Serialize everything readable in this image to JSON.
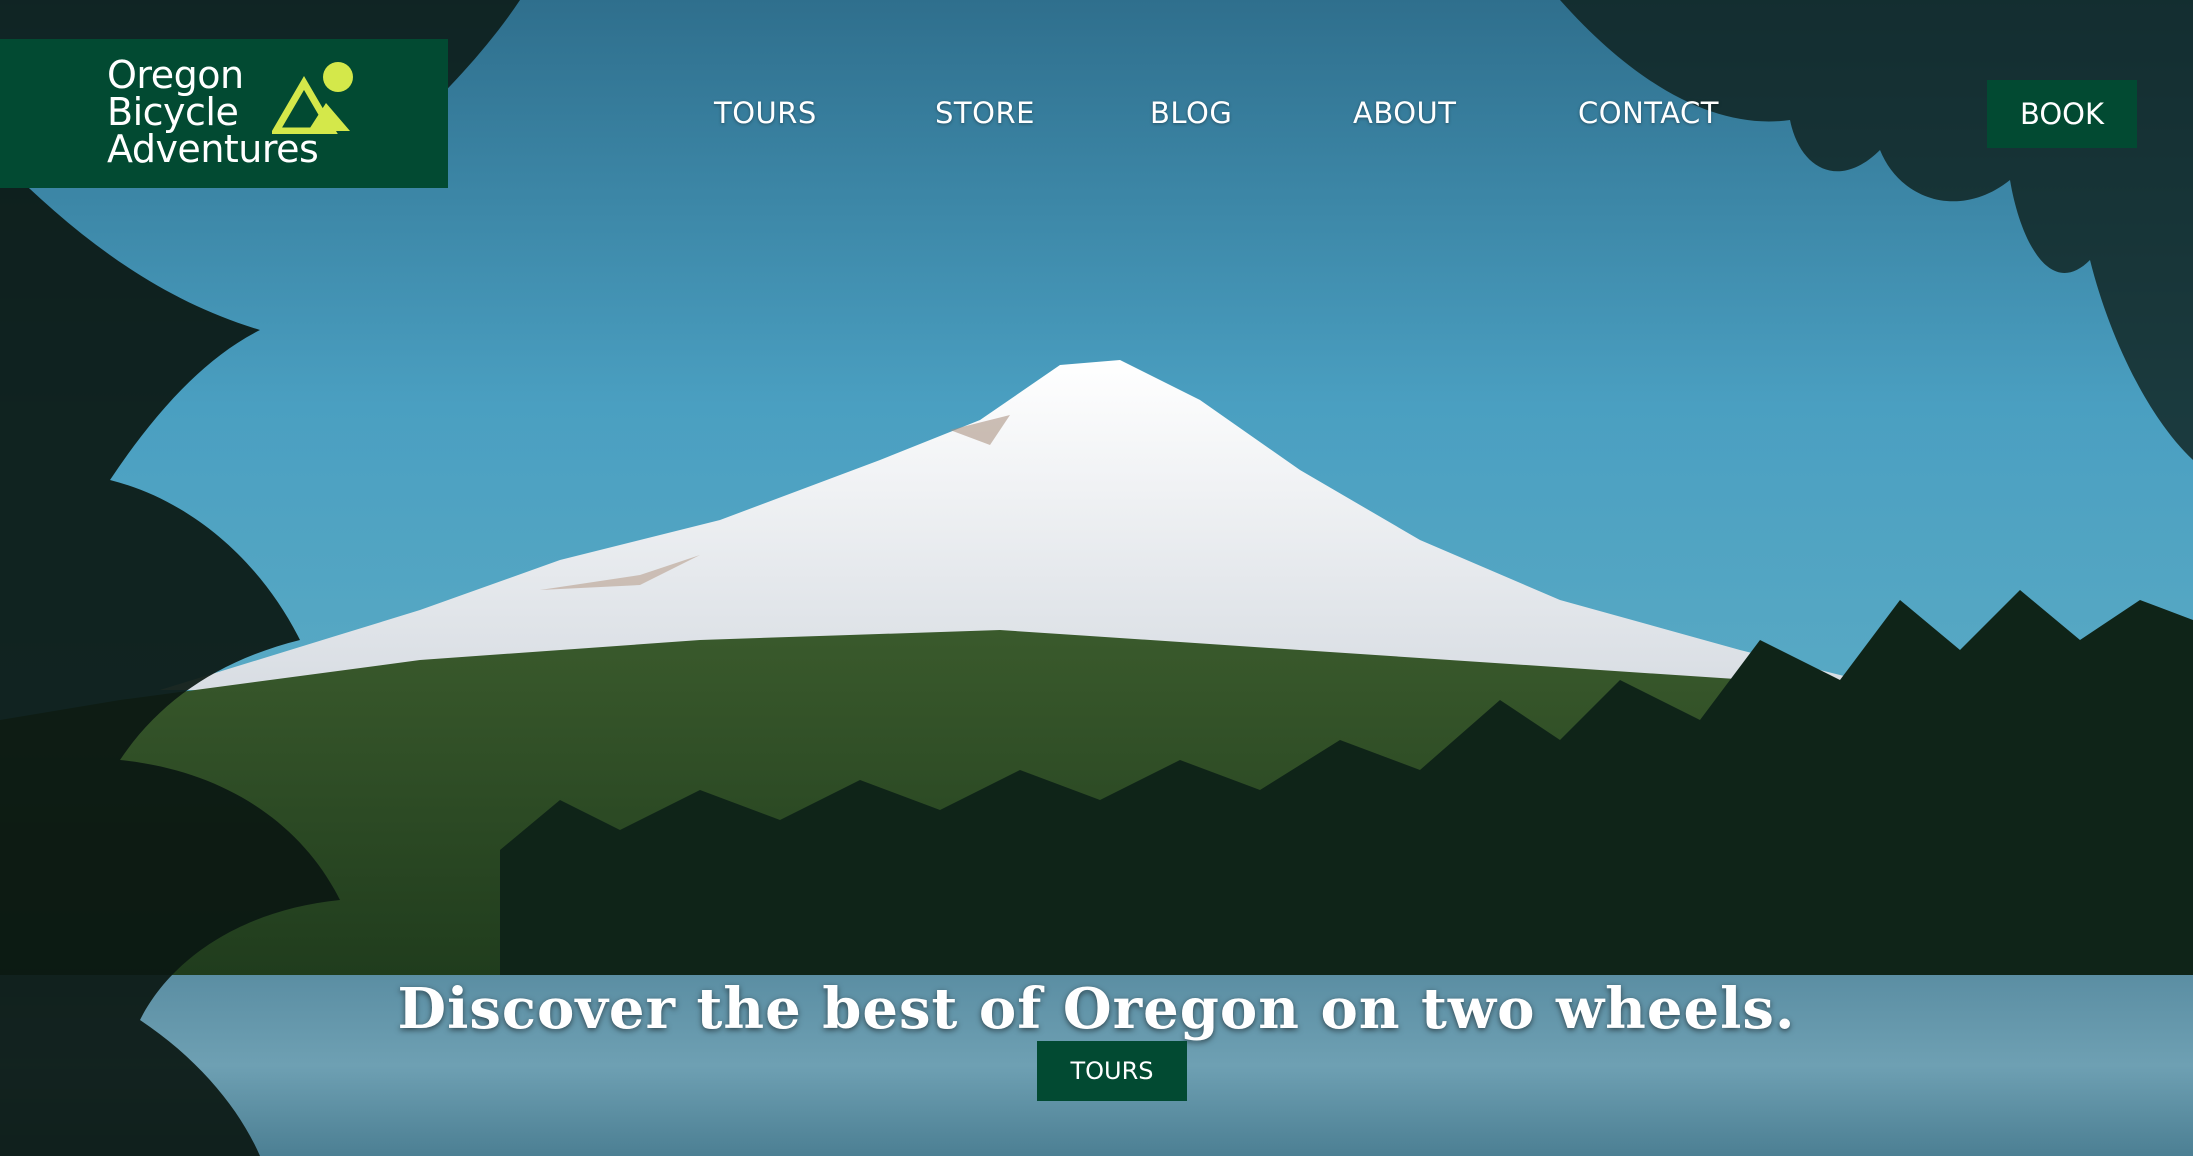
{
  "brand": {
    "line1": "Oregon",
    "line2": "Bicycle",
    "line3": "Adventures",
    "logo_icon": "mountain-sun-icon",
    "bg_color": "#024a32",
    "accent_color": "#d4e84a"
  },
  "nav": {
    "items": [
      {
        "label": "TOURS"
      },
      {
        "label": "STORE"
      },
      {
        "label": "BLOG"
      },
      {
        "label": "ABOUT"
      },
      {
        "label": "CONTACT"
      }
    ],
    "book_label": "BOOK"
  },
  "hero": {
    "headline": "Discover the best of Oregon on two wheels.",
    "cta_label": "TOURS",
    "image_description_icon": "mountain-lake-photo"
  }
}
